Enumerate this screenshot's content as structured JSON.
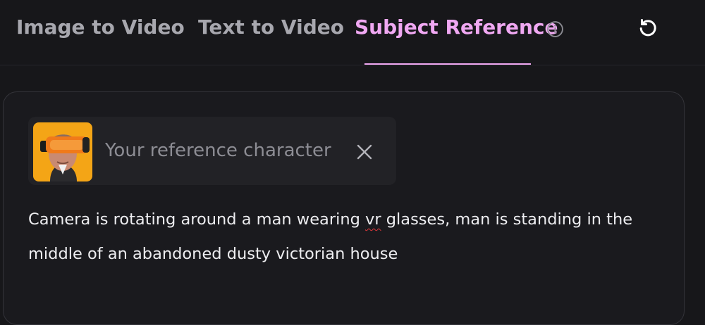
{
  "tabs": [
    {
      "label": "Image to Video",
      "active": false
    },
    {
      "label": "Text to Video",
      "active": false
    },
    {
      "label": "Subject Reference",
      "active": true
    }
  ],
  "icons": {
    "info": "info-icon",
    "refresh": "refresh-icon",
    "close": "close-icon"
  },
  "colors": {
    "active_tab": "#f0a8f2",
    "inactive_tab": "#a7a7ae",
    "background": "#17171a",
    "spellcheck": "#e0383b"
  },
  "reference": {
    "label": "Your reference character"
  },
  "prompt": {
    "before": "Camera is rotating around a man wearing ",
    "misspelled": "vr",
    "after": " glasses, man is standing in the middle of an abandoned dusty victorian house"
  }
}
